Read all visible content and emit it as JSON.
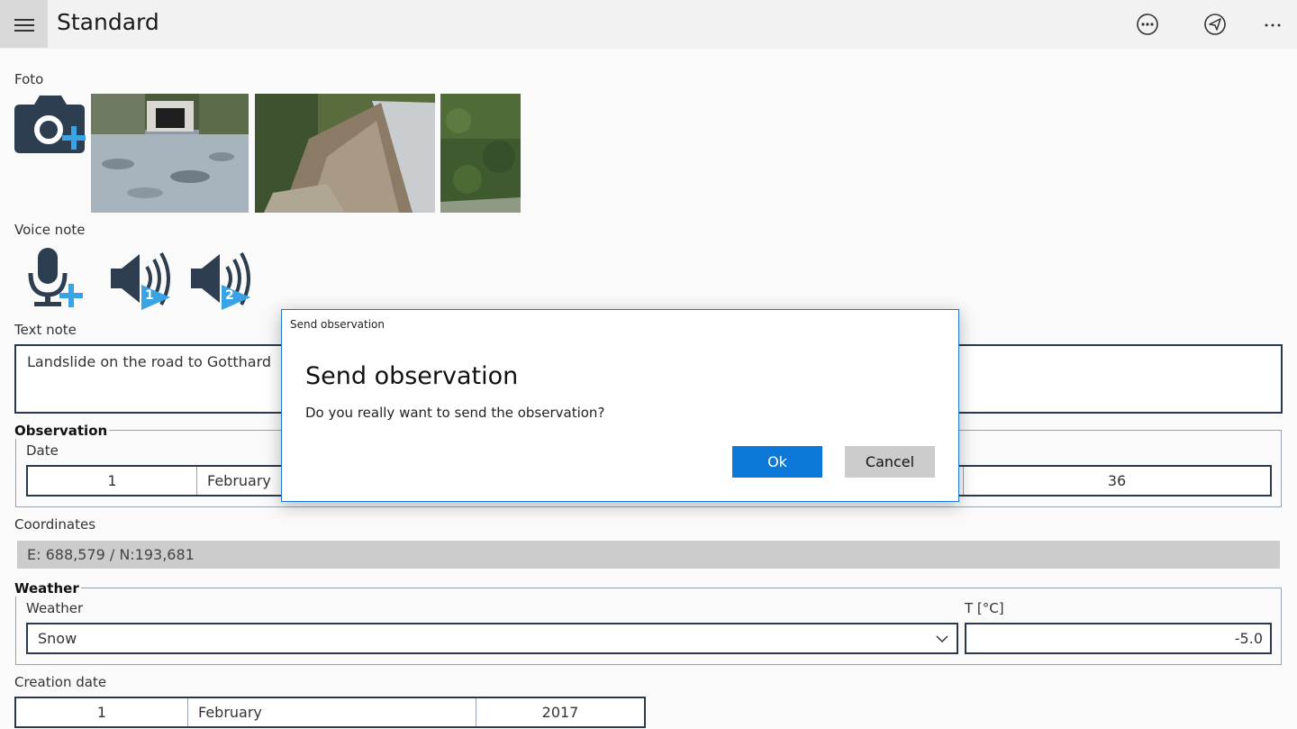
{
  "header": {
    "title": "Standard"
  },
  "foto": {
    "label": "Foto"
  },
  "voice": {
    "label": "Voice note",
    "badge1": "1",
    "badge2": "2"
  },
  "text_note": {
    "label": "Text note",
    "value": "Landslide on the road to Gotthard"
  },
  "observation": {
    "legend": "Observation",
    "date_label": "Date",
    "day": "1",
    "month": "February",
    "extra_value": "36"
  },
  "coordinates": {
    "label": "Coordinates",
    "value": "E: 688,579 / N:193,681"
  },
  "weather": {
    "legend": "Weather",
    "weather_label": "Weather",
    "weather_value": "Snow",
    "temp_label": "T [°C]",
    "temp_value": "-5.0"
  },
  "creation": {
    "label": "Creation date",
    "day": "1",
    "month": "February",
    "year": "2017"
  },
  "dialog": {
    "caption": "Send observation",
    "title": "Send observation",
    "message": "Do you really want to send the observation?",
    "ok_label": "Ok",
    "cancel_label": "Cancel"
  },
  "colors": {
    "accent": "#0c78d7",
    "icon": "#2d3e50",
    "icon_accent": "#3aa3e3"
  }
}
